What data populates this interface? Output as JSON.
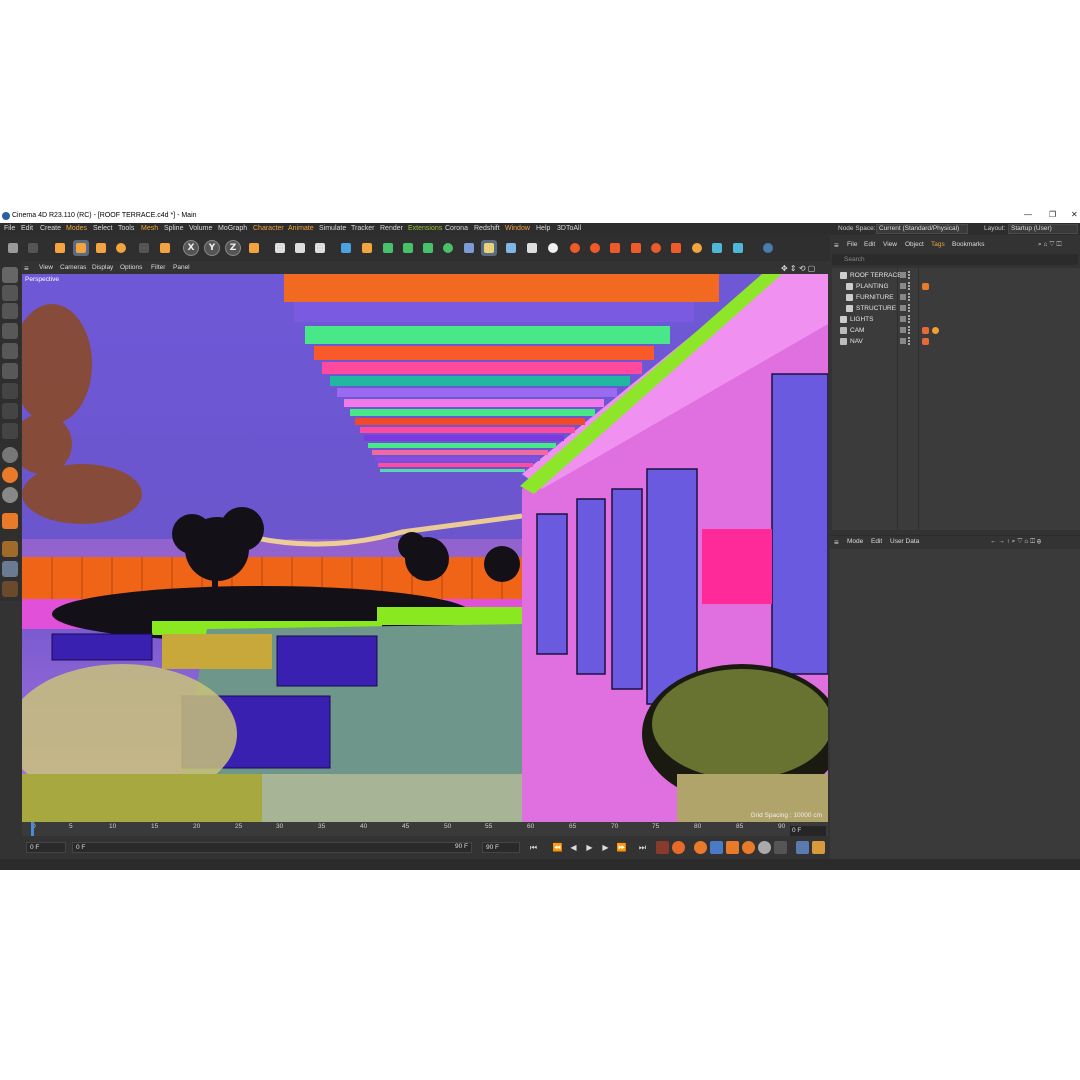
{
  "window": {
    "title": "Cinema 4D R23.110 (RC) - [ROOF TERRACE.c4d *] - Main",
    "controls": [
      "—",
      "❐",
      "✕"
    ]
  },
  "menu": [
    "File",
    "Edit",
    "Create",
    "Modes",
    "Select",
    "Tools",
    "Mesh",
    "Spline",
    "Volume",
    "MoGraph",
    "Character",
    "Animate",
    "Simulate",
    "Tracker",
    "Render",
    "Extensions",
    "Corona",
    "Redshift",
    "Window",
    "Help",
    "3DToAll"
  ],
  "node_space": {
    "label": "Node Space:",
    "value": "Current (Standard/Physical)"
  },
  "layout": {
    "label": "Layout:",
    "value": "Startup (User)"
  },
  "toolbar": {
    "axis_x": "X",
    "axis_y": "Y",
    "axis_z": "Z"
  },
  "viewport": {
    "menu": [
      "View",
      "Cameras",
      "Display",
      "Options",
      "Filter",
      "Panel"
    ],
    "label": "Perspective",
    "grid_spacing": "Grid Spacing : 10000 cm"
  },
  "timeline": {
    "ticks": [
      "0",
      "5",
      "10",
      "15",
      "20",
      "25",
      "30",
      "35",
      "40",
      "45",
      "50",
      "55",
      "60",
      "65",
      "70",
      "75",
      "80",
      "85",
      "90"
    ],
    "current_frame": "0 F",
    "start_field": "0 F",
    "range_start": "0 F",
    "range_end": "90 F",
    "end_field": "90 F"
  },
  "object_manager": {
    "menu": [
      "File",
      "Edit",
      "View",
      "Object",
      "Tags",
      "Bookmarks"
    ],
    "search_placeholder": "Search",
    "objects": [
      {
        "name": "ROOF TERRACE",
        "depth": 0,
        "tags": []
      },
      {
        "name": "PLANTING",
        "depth": 1,
        "tags": [
          "material"
        ]
      },
      {
        "name": "FURNITURE",
        "depth": 1,
        "tags": []
      },
      {
        "name": "STRUCTURE",
        "depth": 1,
        "tags": []
      },
      {
        "name": "LIGHTS",
        "depth": 0,
        "tags": []
      },
      {
        "name": "CAM",
        "depth": 0,
        "tags": [
          "camera",
          "protection"
        ]
      },
      {
        "name": "NAV",
        "depth": 0,
        "tags": [
          "camera"
        ]
      }
    ]
  },
  "attribute_manager": {
    "menu": [
      "Mode",
      "Edit",
      "User Data"
    ]
  },
  "colors": {
    "accent": "#f3a33f",
    "highlight_green": "#97c43c",
    "ui_bg": "#333333"
  }
}
